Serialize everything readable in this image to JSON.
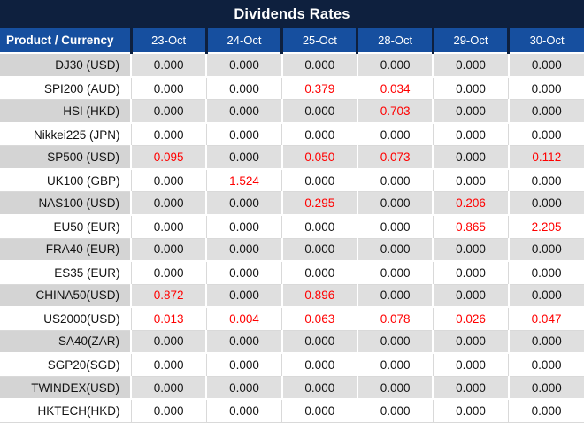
{
  "title": "Dividends Rates",
  "colors": {
    "title_bar_navy": "#0E203E",
    "header_blue": "#164F9F",
    "gray_row_product": "#D4D4D4",
    "gray_row_cell": "#DFDFDF",
    "grid_light": "#D9D9D9",
    "negative_red": "#FF0000",
    "text_black": "#121212"
  },
  "table": {
    "product_header": "Product / Currency",
    "date_headers": [
      "23-Oct",
      "24-Oct",
      "25-Oct",
      "28-Oct",
      "29-Oct",
      "30-Oct"
    ],
    "rows": [
      {
        "product": "DJ30 (USD)",
        "values": [
          "0.000",
          "0.000",
          "0.000",
          "0.000",
          "0.000",
          "0.000"
        ],
        "red_cols": []
      },
      {
        "product": "SPI200 (AUD)",
        "values": [
          "0.000",
          "0.000",
          "0.379",
          "0.034",
          "0.000",
          "0.000"
        ],
        "red_cols": [
          2,
          3
        ]
      },
      {
        "product": "HSI (HKD)",
        "values": [
          "0.000",
          "0.000",
          "0.000",
          "0.703",
          "0.000",
          "0.000"
        ],
        "red_cols": [
          3
        ]
      },
      {
        "product": "Nikkei225 (JPN)",
        "values": [
          "0.000",
          "0.000",
          "0.000",
          "0.000",
          "0.000",
          "0.000"
        ],
        "red_cols": []
      },
      {
        "product": "SP500 (USD)",
        "values": [
          "0.095",
          "0.000",
          "0.050",
          "0.073",
          "0.000",
          "0.112"
        ],
        "red_cols": [
          0,
          2,
          3,
          5
        ]
      },
      {
        "product": "UK100 (GBP)",
        "values": [
          "0.000",
          "1.524",
          "0.000",
          "0.000",
          "0.000",
          "0.000"
        ],
        "red_cols": [
          1
        ]
      },
      {
        "product": "NAS100 (USD)",
        "values": [
          "0.000",
          "0.000",
          "0.295",
          "0.000",
          "0.206",
          "0.000"
        ],
        "red_cols": [
          2,
          4
        ]
      },
      {
        "product": "EU50 (EUR)",
        "values": [
          "0.000",
          "0.000",
          "0.000",
          "0.000",
          "0.865",
          "2.205"
        ],
        "red_cols": [
          4,
          5
        ]
      },
      {
        "product": "FRA40 (EUR)",
        "values": [
          "0.000",
          "0.000",
          "0.000",
          "0.000",
          "0.000",
          "0.000"
        ],
        "red_cols": []
      },
      {
        "product": "ES35 (EUR)",
        "values": [
          "0.000",
          "0.000",
          "0.000",
          "0.000",
          "0.000",
          "0.000"
        ],
        "red_cols": []
      },
      {
        "product": "CHINA50(USD)",
        "values": [
          "0.872",
          "0.000",
          "0.896",
          "0.000",
          "0.000",
          "0.000"
        ],
        "red_cols": [
          0,
          2
        ]
      },
      {
        "product": "US2000(USD)",
        "values": [
          "0.013",
          "0.004",
          "0.063",
          "0.078",
          "0.026",
          "0.047"
        ],
        "red_cols": [
          0,
          1,
          2,
          3,
          4,
          5
        ]
      },
      {
        "product": "SA40(ZAR)",
        "values": [
          "0.000",
          "0.000",
          "0.000",
          "0.000",
          "0.000",
          "0.000"
        ],
        "red_cols": []
      },
      {
        "product": "SGP20(SGD)",
        "values": [
          "0.000",
          "0.000",
          "0.000",
          "0.000",
          "0.000",
          "0.000"
        ],
        "red_cols": []
      },
      {
        "product": "TWINDEX(USD)",
        "values": [
          "0.000",
          "0.000",
          "0.000",
          "0.000",
          "0.000",
          "0.000"
        ],
        "red_cols": []
      },
      {
        "product": "HKTECH(HKD)",
        "values": [
          "0.000",
          "0.000",
          "0.000",
          "0.000",
          "0.000",
          "0.000"
        ],
        "red_cols": []
      }
    ]
  }
}
